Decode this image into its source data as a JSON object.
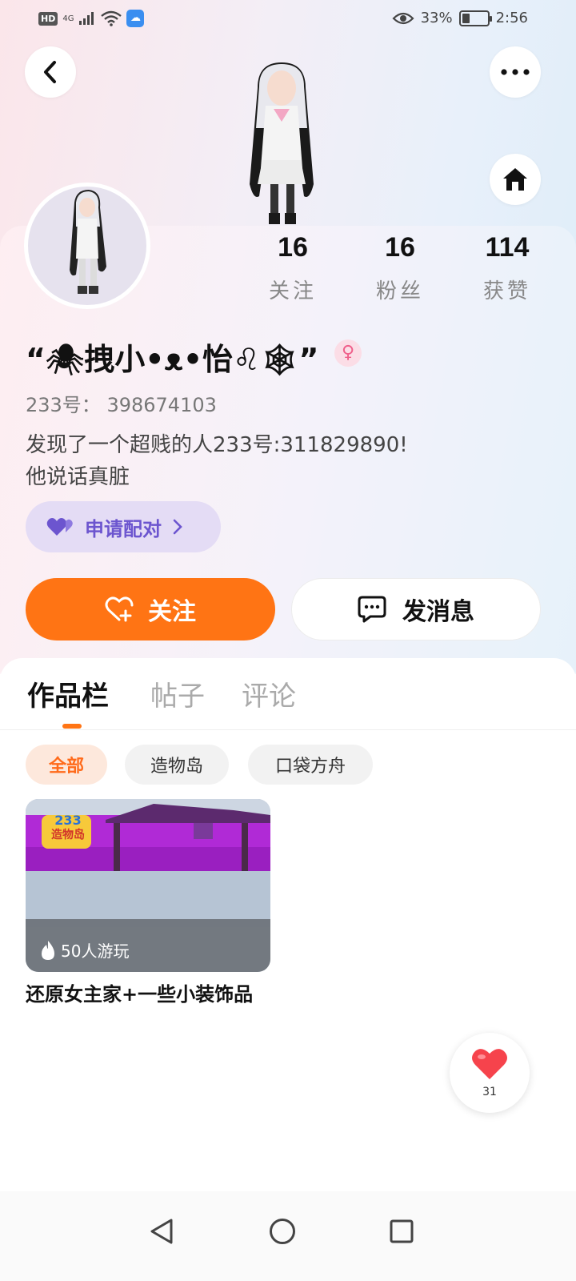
{
  "status_bar": {
    "hd": "HD",
    "network": "4G",
    "battery_pct": "33%",
    "battery_level": 0.33,
    "time": "2:56"
  },
  "header": {
    "back_icon": "chevron-left-icon",
    "more_icon": "ellipsis-icon",
    "home_icon": "home-icon"
  },
  "profile": {
    "stats": [
      {
        "value": "16",
        "label": "关注"
      },
      {
        "value": "16",
        "label": "粉丝"
      },
      {
        "value": "114",
        "label": "获赞"
      }
    ],
    "nickname": "“🕷拽小•ᴥ•怡♌🕸”",
    "gender": "♀",
    "id_label": "233号：",
    "id_value": "398674103",
    "bio_line1": "发现了一个超贱的人233号:311829890!",
    "bio_line2": "他说话真脏",
    "pair_button": "申请配对",
    "follow_button": "关注",
    "message_button": "发消息"
  },
  "tabs": [
    "作品栏",
    "帖子",
    "评论"
  ],
  "active_tab": 0,
  "filters": [
    "全部",
    "造物岛",
    "口袋方舟"
  ],
  "works": [
    {
      "badge_number": "233",
      "badge_name": "造物岛",
      "plays": "50人游玩",
      "title": "还原女主家+一些小装饰品"
    }
  ],
  "like_float": {
    "count": "31"
  },
  "colors": {
    "accent": "#ff7414",
    "pair_purple": "#6c55cf",
    "pair_bg": "#e4dcf5"
  }
}
